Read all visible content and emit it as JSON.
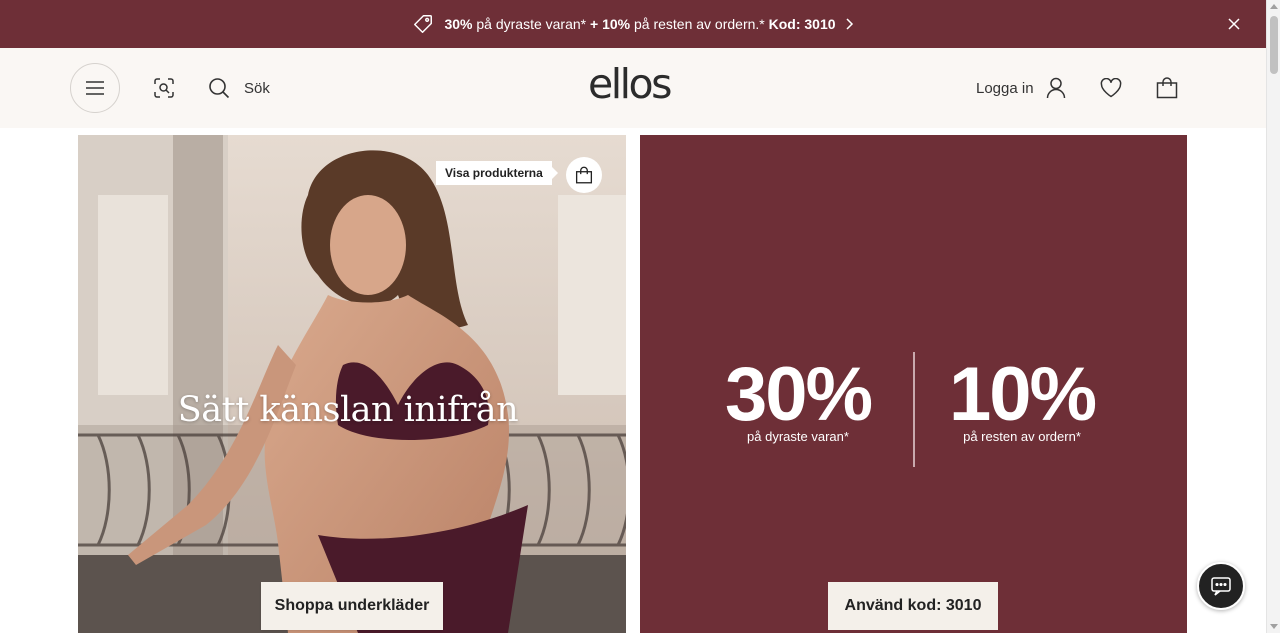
{
  "promo": {
    "part1_bold": "30%",
    "part1": " på dyraste varan*",
    "part2_bold": " + 10%",
    "part2": " på resten av ordern.*",
    "part3_bold": " Kod: 3010"
  },
  "header": {
    "search_label": "Sök",
    "logo": "ellos",
    "login_label": "Logga in"
  },
  "hero_left": {
    "title": "Sätt känslan inifrån",
    "products_tag": "Visa produkterna",
    "cta": "Shoppa underkläder"
  },
  "hero_right": {
    "offer1_value": "30%",
    "offer1_desc": "på dyraste varan*",
    "offer2_value": "10%",
    "offer2_desc": "på resten av ordern*",
    "cta": "Använd kod: 3010"
  },
  "colors": {
    "brand": "#6e2f37",
    "header_bg": "#faf7f4",
    "button_bg": "#f4f0ea"
  },
  "icons": [
    "tag-icon",
    "chevron-right-icon",
    "close-icon",
    "menu-icon",
    "visual-search-icon",
    "search-icon",
    "user-icon",
    "heart-icon",
    "bag-icon",
    "chat-icon"
  ]
}
